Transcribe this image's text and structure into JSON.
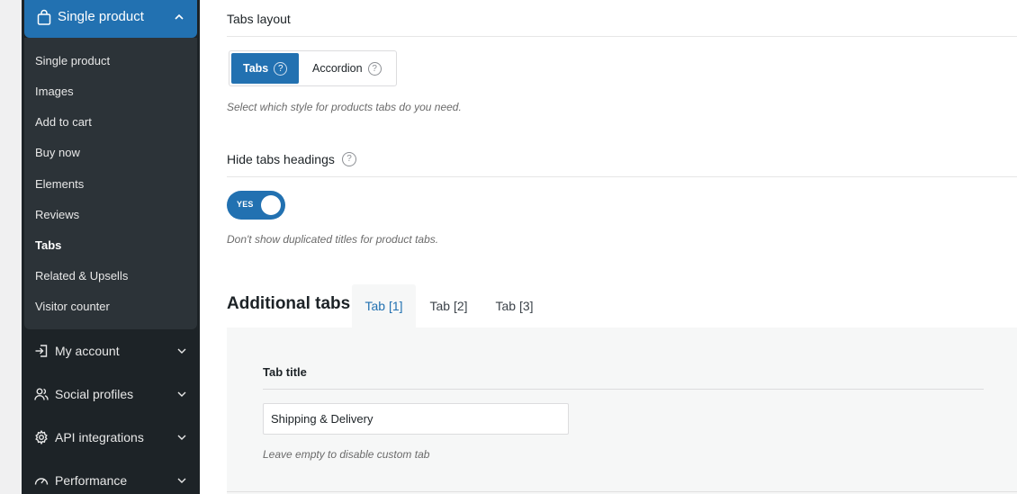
{
  "sidebar": {
    "current_section": {
      "label": "Single product",
      "icon": "bag-icon"
    },
    "sub_items": [
      {
        "label": "Single product",
        "active": false
      },
      {
        "label": "Images",
        "active": false
      },
      {
        "label": "Add to cart",
        "active": false
      },
      {
        "label": "Buy now",
        "active": false
      },
      {
        "label": "Elements",
        "active": false
      },
      {
        "label": "Reviews",
        "active": false
      },
      {
        "label": "Tabs",
        "active": true
      },
      {
        "label": "Related & Upsells",
        "active": false
      },
      {
        "label": "Visitor counter",
        "active": false
      }
    ],
    "sections": [
      {
        "label": "My account",
        "icon": "login-icon"
      },
      {
        "label": "Social profiles",
        "icon": "users-icon"
      },
      {
        "label": "API integrations",
        "icon": "gear-icon"
      },
      {
        "label": "Performance",
        "icon": "gauge-icon"
      }
    ]
  },
  "main": {
    "tabs_layout": {
      "title": "Tabs layout",
      "options": [
        {
          "label": "Tabs",
          "selected": true
        },
        {
          "label": "Accordion",
          "selected": false
        }
      ],
      "help_glyph": "?",
      "description": "Select which style for products tabs do you need."
    },
    "hide_headings": {
      "title": "Hide tabs headings",
      "help_glyph": "?",
      "toggle_label": "YES",
      "toggle_on": true,
      "description": "Don't show duplicated titles for product tabs."
    },
    "additional_tabs": {
      "title": "Additional tabs",
      "tabs": [
        {
          "label": "Tab [1]",
          "active": true
        },
        {
          "label": "Tab [2]",
          "active": false
        },
        {
          "label": "Tab [3]",
          "active": false
        }
      ],
      "field": {
        "title": "Tab title",
        "value": "Shipping & Delivery",
        "description": "Leave empty to disable custom tab"
      }
    }
  },
  "colors": {
    "accent": "#2271b1",
    "sidebar_bg": "#1d2327",
    "submenu_bg": "#2c3338",
    "panel_bg": "#f6f7f7"
  }
}
